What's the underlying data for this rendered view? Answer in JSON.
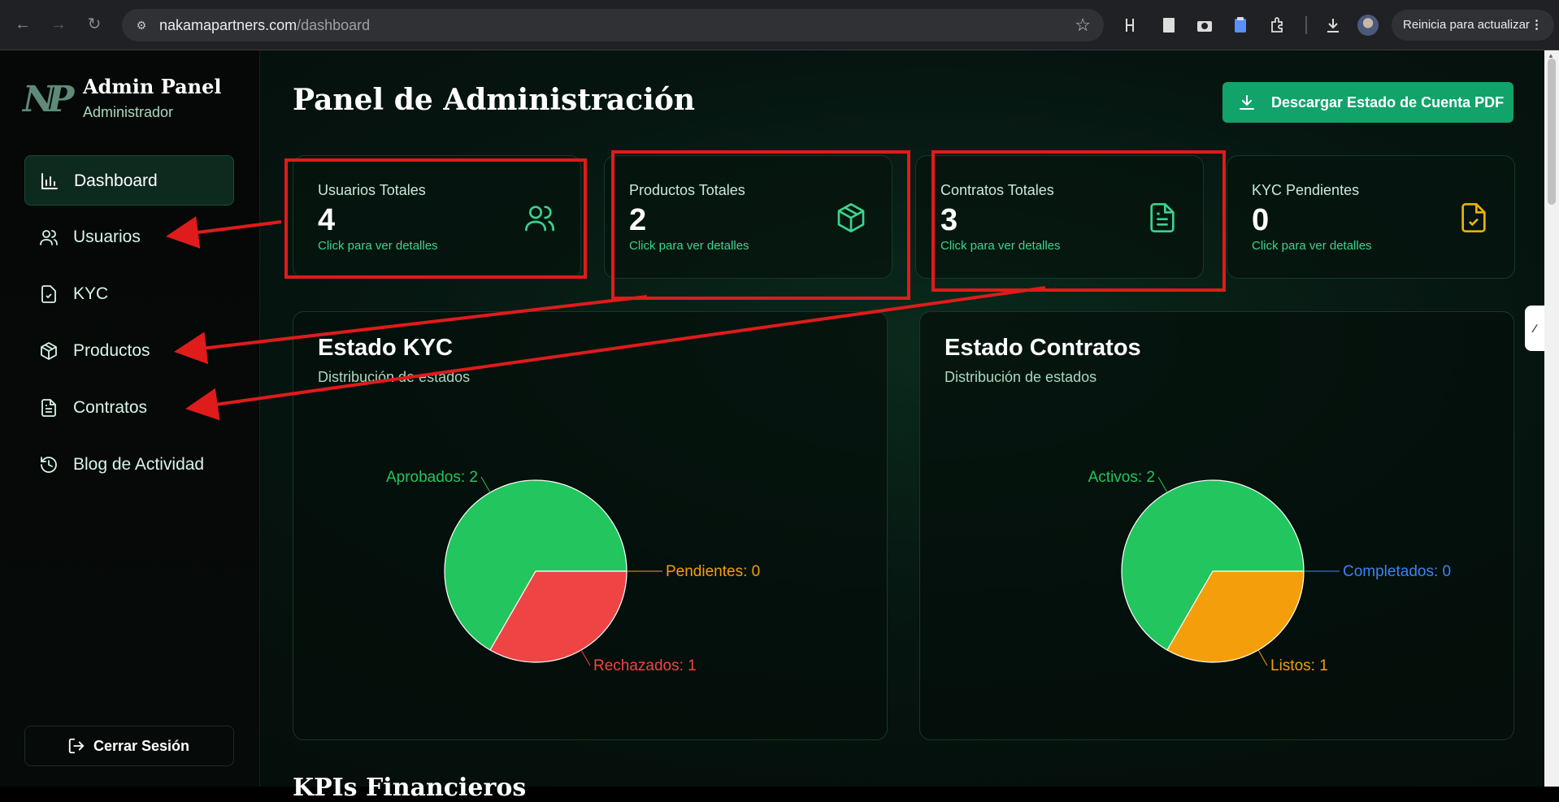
{
  "browser": {
    "url_host": "nakamapartners.com",
    "url_path": "/dashboard",
    "update_label": "Reinicia para actualizar"
  },
  "sidebar": {
    "brand_title": "Admin Panel",
    "brand_subtitle": "Administrador",
    "brand_logo_text": "NP",
    "items": [
      {
        "label": "Dashboard",
        "icon": "bar-chart-icon",
        "active": true
      },
      {
        "label": "Usuarios",
        "icon": "users-icon"
      },
      {
        "label": "KYC",
        "icon": "file-check-icon"
      },
      {
        "label": "Productos",
        "icon": "package-icon"
      },
      {
        "label": "Contratos",
        "icon": "file-text-icon"
      },
      {
        "label": "Blog de Actividad",
        "icon": "history-icon"
      }
    ],
    "logout_label": "Cerrar Sesión"
  },
  "main": {
    "title": "Panel de Administración",
    "download_label": "Descargar Estado de Cuenta PDF",
    "cards": [
      {
        "title": "Usuarios Totales",
        "value": "4",
        "link": "Click para ver detalles",
        "icon": "users-icon",
        "icon_color": "#3bd38e"
      },
      {
        "title": "Productos Totales",
        "value": "2",
        "link": "Click para ver detalles",
        "icon": "package-icon",
        "icon_color": "#3bd38e"
      },
      {
        "title": "Contratos Totales",
        "value": "3",
        "link": "Click para ver detalles",
        "icon": "file-text-icon",
        "icon_color": "#3bd38e"
      },
      {
        "title": "KYC Pendientes",
        "value": "0",
        "link": "Click para ver detalles",
        "icon": "file-check-icon",
        "icon_color": "#eab308"
      }
    ],
    "next_section_heading": "KPIs Financieros"
  },
  "chart_data": [
    {
      "type": "pie",
      "title": "Estado KYC",
      "subtitle": "Distribución de estados",
      "slices": [
        {
          "label": "Aprobados",
          "value": 2,
          "color": "#22c55e",
          "label_text": "Aprobados: 2"
        },
        {
          "label": "Rechazados",
          "value": 1,
          "color": "#ef4444",
          "label_text": "Rechazados: 1"
        },
        {
          "label": "Pendientes",
          "value": 0,
          "color": "#f59e0b",
          "label_text": "Pendientes: 0"
        }
      ]
    },
    {
      "type": "pie",
      "title": "Estado Contratos",
      "subtitle": "Distribución de estados",
      "slices": [
        {
          "label": "Activos",
          "value": 2,
          "color": "#22c55e",
          "label_text": "Activos: 2"
        },
        {
          "label": "Listos",
          "value": 1,
          "color": "#f59e0b",
          "label_text": "Listos: 1"
        },
        {
          "label": "Completados",
          "value": 0,
          "color": "#3b82f6",
          "label_text": "Completados: 0"
        }
      ]
    }
  ],
  "colors": {
    "accent": "#12a36a",
    "annotation_red": "#e01b1b"
  }
}
